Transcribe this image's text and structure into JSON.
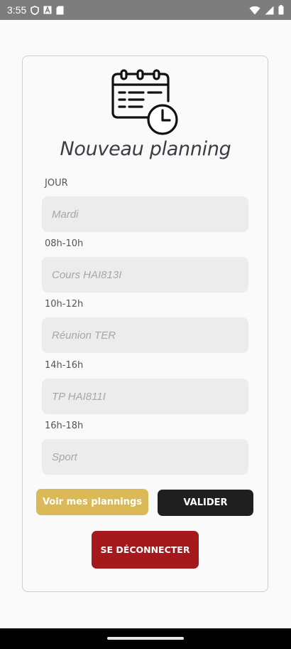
{
  "status_bar": {
    "time": "3:55",
    "left_icons": [
      "shield-icon",
      "font-a-icon",
      "sd-card-icon"
    ],
    "right_icons": [
      "wifi-icon",
      "signal-icon",
      "battery-icon"
    ]
  },
  "header": {
    "icon": "calendar-clock-icon",
    "title": "Nouveau planning"
  },
  "form": {
    "fields": [
      {
        "label": "JOUR",
        "placeholder": "Mardi"
      },
      {
        "label": "08h-10h",
        "placeholder": "Cours HAI813I"
      },
      {
        "label": "10h-12h",
        "placeholder": "Réunion TER"
      },
      {
        "label": "14h-16h",
        "placeholder": "TP HAI811I"
      },
      {
        "label": "16h-18h",
        "placeholder": "Sport"
      }
    ]
  },
  "actions": {
    "view_plannings": "Voir mes plannings",
    "submit": "VALIDER",
    "logout": "SE DÉCONNECTER"
  },
  "colors": {
    "accent_gold": "#dcb957",
    "dark": "#1f1f1f",
    "danger": "#a5191c"
  }
}
